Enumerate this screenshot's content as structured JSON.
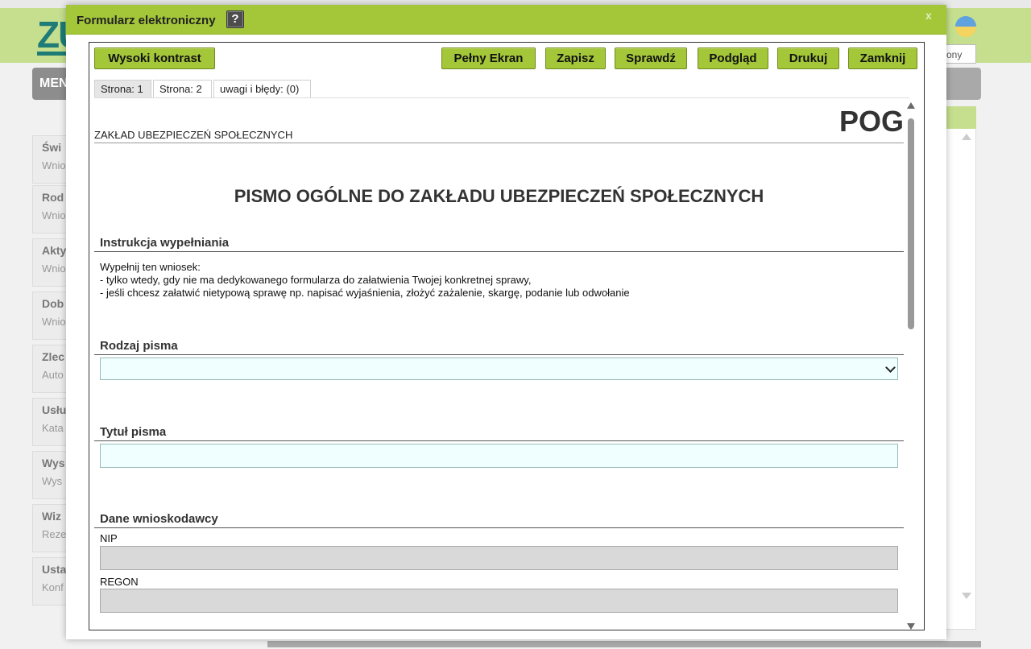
{
  "background": {
    "logo": "ZU",
    "menu_label": "MEN",
    "header_small": "n",
    "right_tab": "ony",
    "sidebar": [
      {
        "title": "Świ",
        "sub": "Wnio"
      },
      {
        "title": "Rod",
        "sub": "Wnio"
      },
      {
        "title": "Akty",
        "sub": "Wnio"
      },
      {
        "title": "Dob",
        "sub": "Wnio"
      },
      {
        "title": "Zlec",
        "sub": "Auto"
      },
      {
        "title": "Usłu",
        "sub": "Kata"
      },
      {
        "title": "Wys",
        "sub": "Wys"
      },
      {
        "title": "Wiz",
        "sub": "Reze"
      },
      {
        "title": "Usta",
        "sub": "Konf"
      }
    ]
  },
  "dialog": {
    "title": "Formularz elektroniczny",
    "help_label": "?",
    "close_label": "x"
  },
  "toolbar": {
    "high_contrast": "Wysoki kontrast",
    "fullscreen": "Pełny Ekran",
    "save": "Zapisz",
    "check": "Sprawdź",
    "preview": "Podgląd",
    "print": "Drukuj",
    "close": "Zamknij"
  },
  "tabs": [
    {
      "label": "Strona: 1",
      "active": true
    },
    {
      "label": "Strona: 2",
      "active": false
    },
    {
      "label": "uwagi i błędy: (0)",
      "active": false
    }
  ],
  "form": {
    "code": "POG",
    "org": "ZAKŁAD UBEZPIECZEŃ SPOŁECZNYCH",
    "title": "PISMO OGÓLNE DO ZAKŁADU UBEZPIECZEŃ SPOŁECZNYCH",
    "instruction_header": "Instrukcja wypełniania",
    "instructions": [
      "Wypełnij ten wniosek:",
      "- tylko wtedy, gdy nie ma dedykowanego formularza do załatwienia Twojej konkretnej sprawy,",
      "- jeśli chcesz załatwić nietypową sprawę np. napisać wyjaśnienia, złożyć zażalenie, skargę, podanie lub odwołanie"
    ],
    "letter_type_header": "Rodzaj pisma",
    "letter_type_value": "",
    "letter_title_header": "Tytuł pisma",
    "letter_title_value": "",
    "applicant_header": "Dane wnioskodawcy",
    "nip_label": "NIP",
    "regon_label": "REGON"
  },
  "colors": {
    "accent_green": "#a4c639",
    "field_bg": "#f0ffff",
    "disabled_bg": "#d9d9d9"
  }
}
